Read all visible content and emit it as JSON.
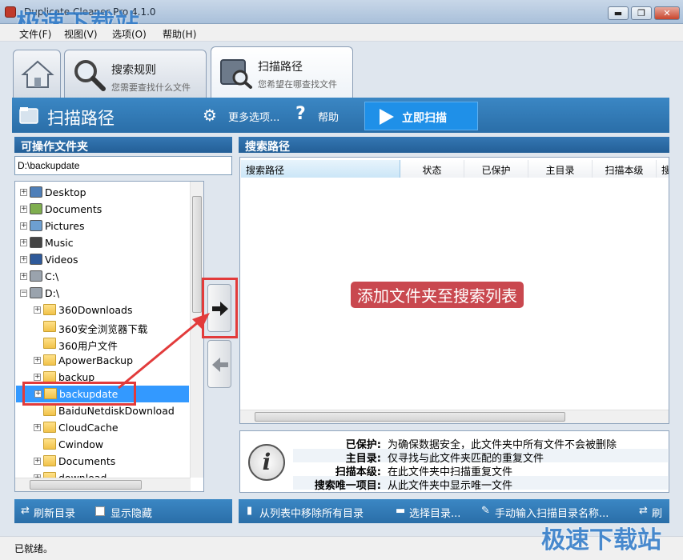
{
  "window": {
    "title": "Duplicate Cleaner Pro 4.1.0",
    "minimize": "▬",
    "maximize": "❐",
    "close": "✕"
  },
  "watermark": "极速下载站",
  "menu": [
    "文件(F)",
    "视图(V)",
    "选项(O)",
    "帮助(H)"
  ],
  "tabs": [
    {
      "title": "",
      "subtitle": "",
      "icon": "home-icon"
    },
    {
      "title": "搜索规则",
      "subtitle": "您需要查找什么文件",
      "icon": "magnifier-icon"
    },
    {
      "title": "扫描路径",
      "subtitle": "您希望在哪查找文件",
      "icon": "scan-path-icon"
    }
  ],
  "toolbar": {
    "title": "扫描路径",
    "more_options": "更多选项...",
    "help": "帮助",
    "scan_now": "立即扫描"
  },
  "left_panel": {
    "header": "可操作文件夹",
    "path_value": "D:\\backupdate",
    "tree": [
      {
        "label": "Desktop",
        "level": 0,
        "icon": "desktop-icon",
        "expander": "+"
      },
      {
        "label": "Documents",
        "level": 0,
        "icon": "documents-icon",
        "expander": "+"
      },
      {
        "label": "Pictures",
        "level": 0,
        "icon": "pictures-icon",
        "expander": "+"
      },
      {
        "label": "Music",
        "level": 0,
        "icon": "music-icon",
        "expander": "+"
      },
      {
        "label": "Videos",
        "level": 0,
        "icon": "videos-icon",
        "expander": "+"
      },
      {
        "label": "C:\\",
        "level": 0,
        "icon": "drive-icon",
        "expander": "+"
      },
      {
        "label": "D:\\",
        "level": 0,
        "icon": "drive-icon",
        "expander": "−"
      },
      {
        "label": "360Downloads",
        "level": 1,
        "icon": "folder-icon",
        "expander": "+"
      },
      {
        "label": "360安全浏览器下载",
        "level": 1,
        "icon": "folder-icon",
        "expander": ""
      },
      {
        "label": "360用户文件",
        "level": 1,
        "icon": "folder-icon",
        "expander": ""
      },
      {
        "label": "ApowerBackup",
        "level": 1,
        "icon": "folder-icon",
        "expander": "+"
      },
      {
        "label": "backup",
        "level": 1,
        "icon": "folder-icon",
        "expander": "+"
      },
      {
        "label": "backupdate",
        "level": 1,
        "icon": "folder-icon",
        "expander": "+",
        "selected": true
      },
      {
        "label": "BaiduNetdiskDownload",
        "level": 1,
        "icon": "folder-icon",
        "expander": ""
      },
      {
        "label": "CloudCache",
        "level": 1,
        "icon": "folder-icon",
        "expander": "+"
      },
      {
        "label": "Cwindow",
        "level": 1,
        "icon": "folder-icon",
        "expander": ""
      },
      {
        "label": "Documents",
        "level": 1,
        "icon": "folder-icon",
        "expander": "+"
      },
      {
        "label": "download",
        "level": 1,
        "icon": "folder-icon",
        "expander": "+"
      }
    ]
  },
  "right_panel": {
    "header": "搜索路径",
    "columns": [
      "搜索路径",
      "状态",
      "已保护",
      "主目录",
      "扫描本级",
      "搜"
    ],
    "hint": "添加文件夹至搜索列表"
  },
  "info": [
    {
      "key": "已保护:",
      "value": "为确保数据安全，此文件夹中所有文件不会被删除"
    },
    {
      "key": "主目录:",
      "value": "仅寻找与此文件夹匹配的重复文件"
    },
    {
      "key": "扫描本级:",
      "value": "在此文件夹中扫描重复文件"
    },
    {
      "key": "搜索唯一项目:",
      "value": "从此文件夹中显示唯一文件"
    }
  ],
  "bottom_left": {
    "refresh": "刷新目录",
    "show_hidden": "显示隐藏"
  },
  "bottom_right": {
    "remove_all": "从列表中移除所有目录",
    "select_dir": "选择目录...",
    "manual_input": "手动输入扫描目录名称...",
    "refresh": "刷"
  },
  "status": "已就绪。",
  "colors": {
    "accent": "#2a6ea8",
    "scan_button": "#1f90e8",
    "highlight": "#e23b3b",
    "hint_bg": "#c9484f"
  }
}
